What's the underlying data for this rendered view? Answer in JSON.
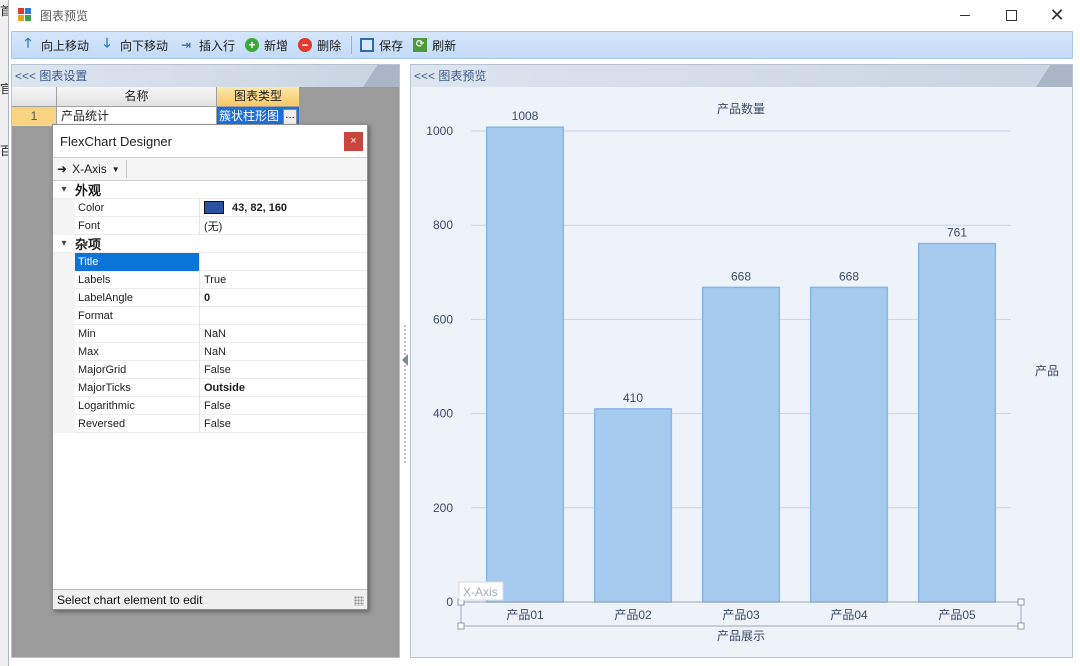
{
  "background_app": {
    "glyphs": [
      "首",
      "官",
      "百"
    ]
  },
  "window": {
    "title": "图表预览"
  },
  "toolbar": {
    "move_up": "向上移动",
    "move_down": "向下移动",
    "insert_row": "插入行",
    "add": "新增",
    "delete": "删除",
    "save": "保存",
    "refresh": "刷新"
  },
  "left_panel": {
    "header": "<<< 图表设置",
    "grid": {
      "columns": [
        "名称",
        "图表类型"
      ],
      "rows": [
        {
          "index": "1",
          "name": "产品统计",
          "type": "簇状柱形图",
          "button": "…"
        }
      ]
    }
  },
  "designer": {
    "title": "FlexChart Designer",
    "close": "×",
    "element_selector": "X-Axis",
    "categories": {
      "appearance": "外观",
      "misc": "杂项"
    },
    "appearance_props": [
      {
        "name": "Color",
        "value": "43, 82, 160",
        "swatch": "#2b52a0",
        "bold": true
      },
      {
        "name": "Font",
        "value": "(无)"
      }
    ],
    "misc_props": [
      {
        "name": "Title",
        "value": "",
        "selected": true
      },
      {
        "name": "Labels",
        "value": "True"
      },
      {
        "name": "LabelAngle",
        "value": "0",
        "bold": true
      },
      {
        "name": "Format",
        "value": ""
      },
      {
        "name": "Min",
        "value": "NaN"
      },
      {
        "name": "Max",
        "value": "NaN"
      },
      {
        "name": "MajorGrid",
        "value": "False"
      },
      {
        "name": "MajorTicks",
        "value": "Outside",
        "bold": true
      },
      {
        "name": "Logarithmic",
        "value": "False"
      },
      {
        "name": "Reversed",
        "value": "False"
      }
    ],
    "status": "Select chart element to edit"
  },
  "right_panel": {
    "header": "<<< 图表预览"
  },
  "chart_data": {
    "type": "bar",
    "title": "产品数量",
    "xlabel": "产品展示",
    "ylabel": "",
    "categories": [
      "产品01",
      "产品02",
      "产品03",
      "产品04",
      "产品05"
    ],
    "series": [
      {
        "name": "产品",
        "values": [
          1008,
          410,
          668,
          668,
          761
        ]
      }
    ],
    "ylim": [
      0,
      1000
    ],
    "yticks": [
      0,
      200,
      400,
      600,
      800,
      1000
    ],
    "grid": true,
    "legend": "right",
    "selected_element_tag": "X-Axis",
    "colors": {
      "bar_fill": "#a7cbee",
      "bar_stroke": "#86b6e6",
      "grid": "#c6d6ea",
      "text": "#3a4a66"
    }
  }
}
